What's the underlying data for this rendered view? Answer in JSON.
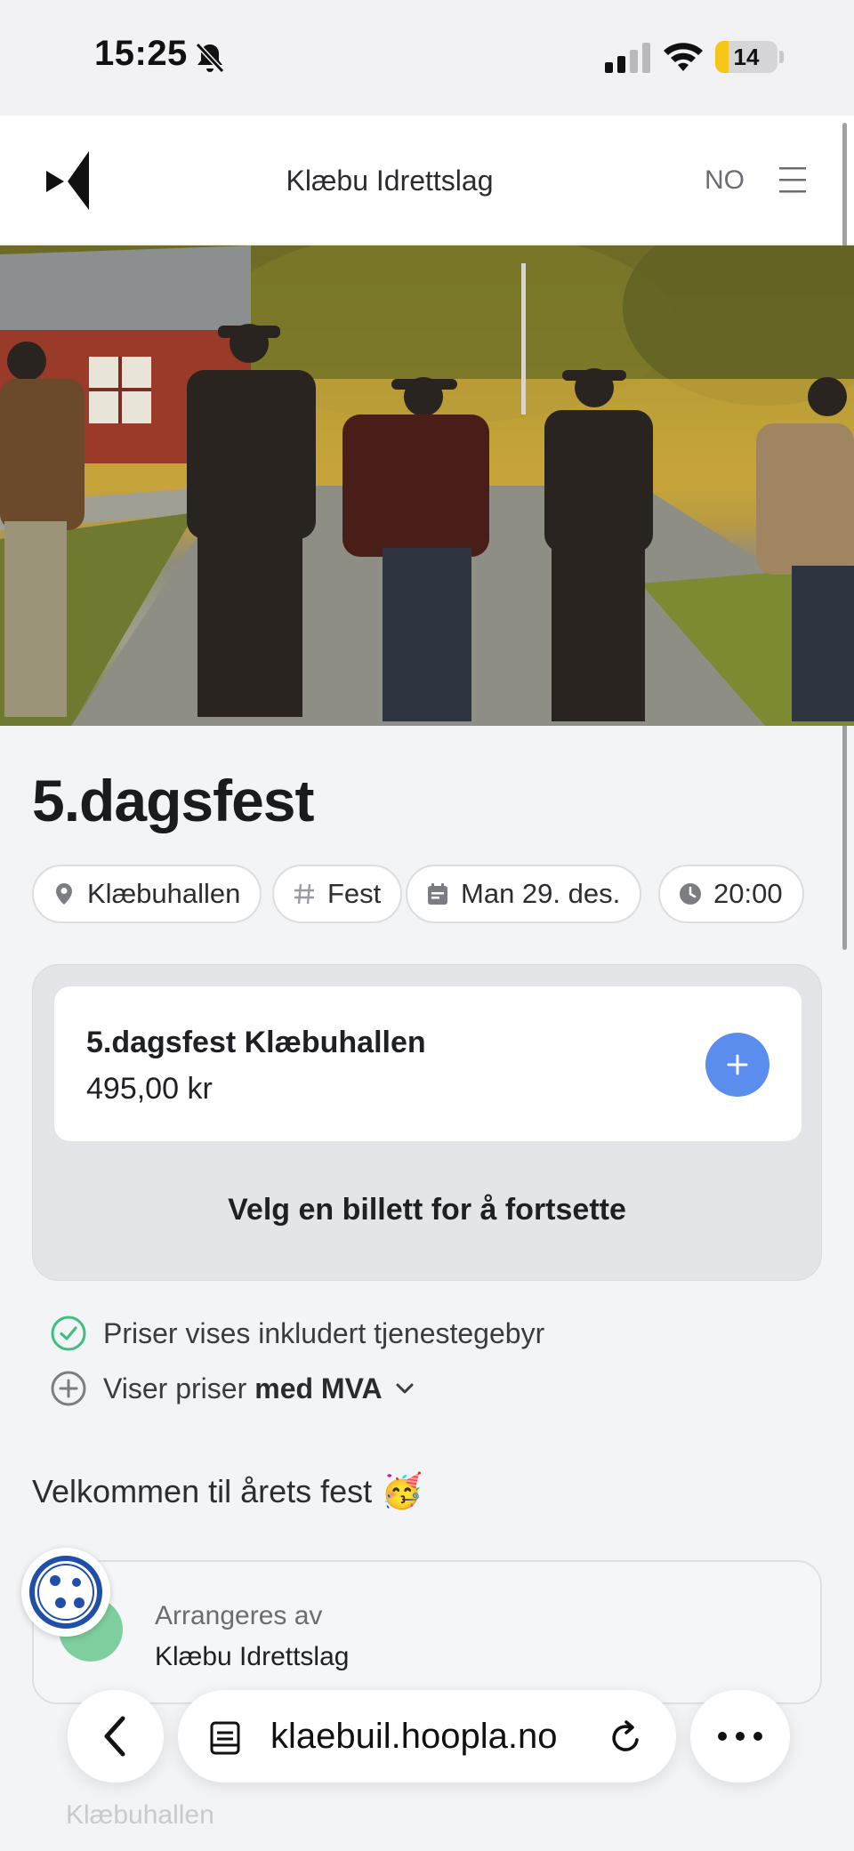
{
  "status_bar": {
    "time": "15:25",
    "battery": "14"
  },
  "header": {
    "org_name": "Klæbu Idrettslag",
    "language": "NO"
  },
  "event": {
    "title": "5.dagsfest",
    "tags": {
      "location": "Klæbuhallen",
      "category": "Fest",
      "date": "Man 29. des.",
      "time": "20:00"
    }
  },
  "ticket": {
    "name": "5.dagsfest Klæbuhallen",
    "price": "495,00 kr",
    "continue_text": "Velg en billett for å fortsette"
  },
  "info": {
    "fee_note": "Priser vises inkludert tjenestegebyr",
    "vat_prefix": "Viser priser",
    "vat_bold": "med MVA"
  },
  "description": {
    "text": "Velkommen til årets fest",
    "emoji": "🥳"
  },
  "organizer": {
    "label": "Arrangeres av",
    "name": "Klæbu Idrettslag"
  },
  "faded": {
    "text": "Klæbuhallen"
  },
  "browser": {
    "url": "klaebuil.hoopla.no"
  },
  "colors": {
    "accent": "#5b8def",
    "check": "#3fbf7f",
    "hero_tint": "#c9a73a"
  }
}
